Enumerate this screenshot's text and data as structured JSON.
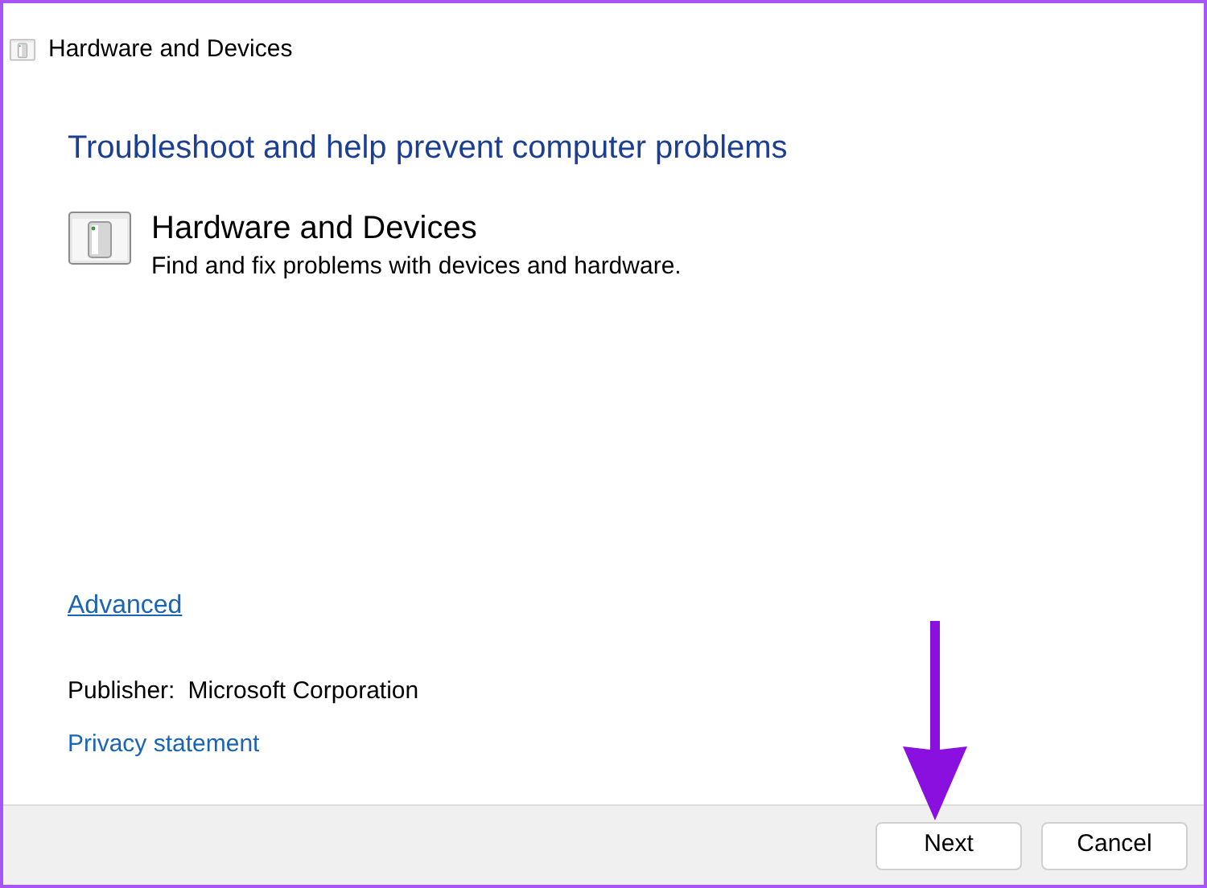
{
  "window": {
    "title": "Hardware and Devices"
  },
  "heading": "Troubleshoot and help prevent computer problems",
  "troubleshooter": {
    "name": "Hardware and Devices",
    "description": "Find and fix problems with devices and hardware."
  },
  "advanced_link": "Advanced",
  "publisher": {
    "label": "Publisher:",
    "value": "Microsoft Corporation"
  },
  "privacy_link": "Privacy statement",
  "buttons": [
    "Next",
    "Cancel"
  ]
}
